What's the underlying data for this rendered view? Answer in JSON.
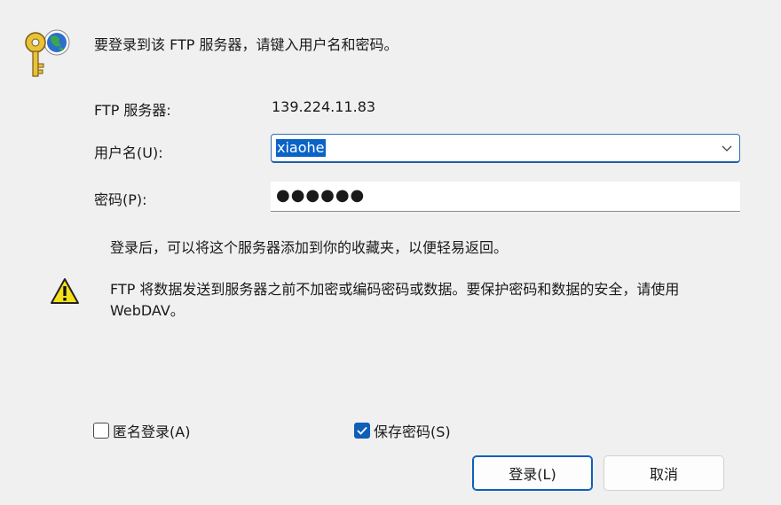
{
  "dialog": {
    "prompt": "要登录到该 FTP 服务器，请键入用户名和密码。",
    "server": {
      "label": "FTP 服务器:",
      "value": "139.224.11.83"
    },
    "username": {
      "label": "用户名(U):",
      "value": "xiaohe"
    },
    "password": {
      "label": "密码(P):",
      "masked": "●●●●●●"
    },
    "info_text": "登录后，可以将这个服务器添加到你的收藏夹，以便轻易返回。",
    "warning_text": "FTP 将数据发送到服务器之前不加密或编码密码或数据。要保护密码和数据的安全，请使用 WebDAV。",
    "anonymous": {
      "label": "匿名登录(A)",
      "checked": false
    },
    "save_password": {
      "label": "保存密码(S)",
      "checked": true
    },
    "buttons": {
      "login": "登录(L)",
      "cancel": "取消"
    }
  },
  "icons": {
    "header": "key-globe-icon",
    "warning": "warning-icon",
    "dropdown": "chevron-down-icon",
    "checkmark": "checkmark-icon"
  },
  "colors": {
    "accent": "#0f5fb8",
    "background": "#f0f0f0",
    "selection": "#0a64c8"
  }
}
